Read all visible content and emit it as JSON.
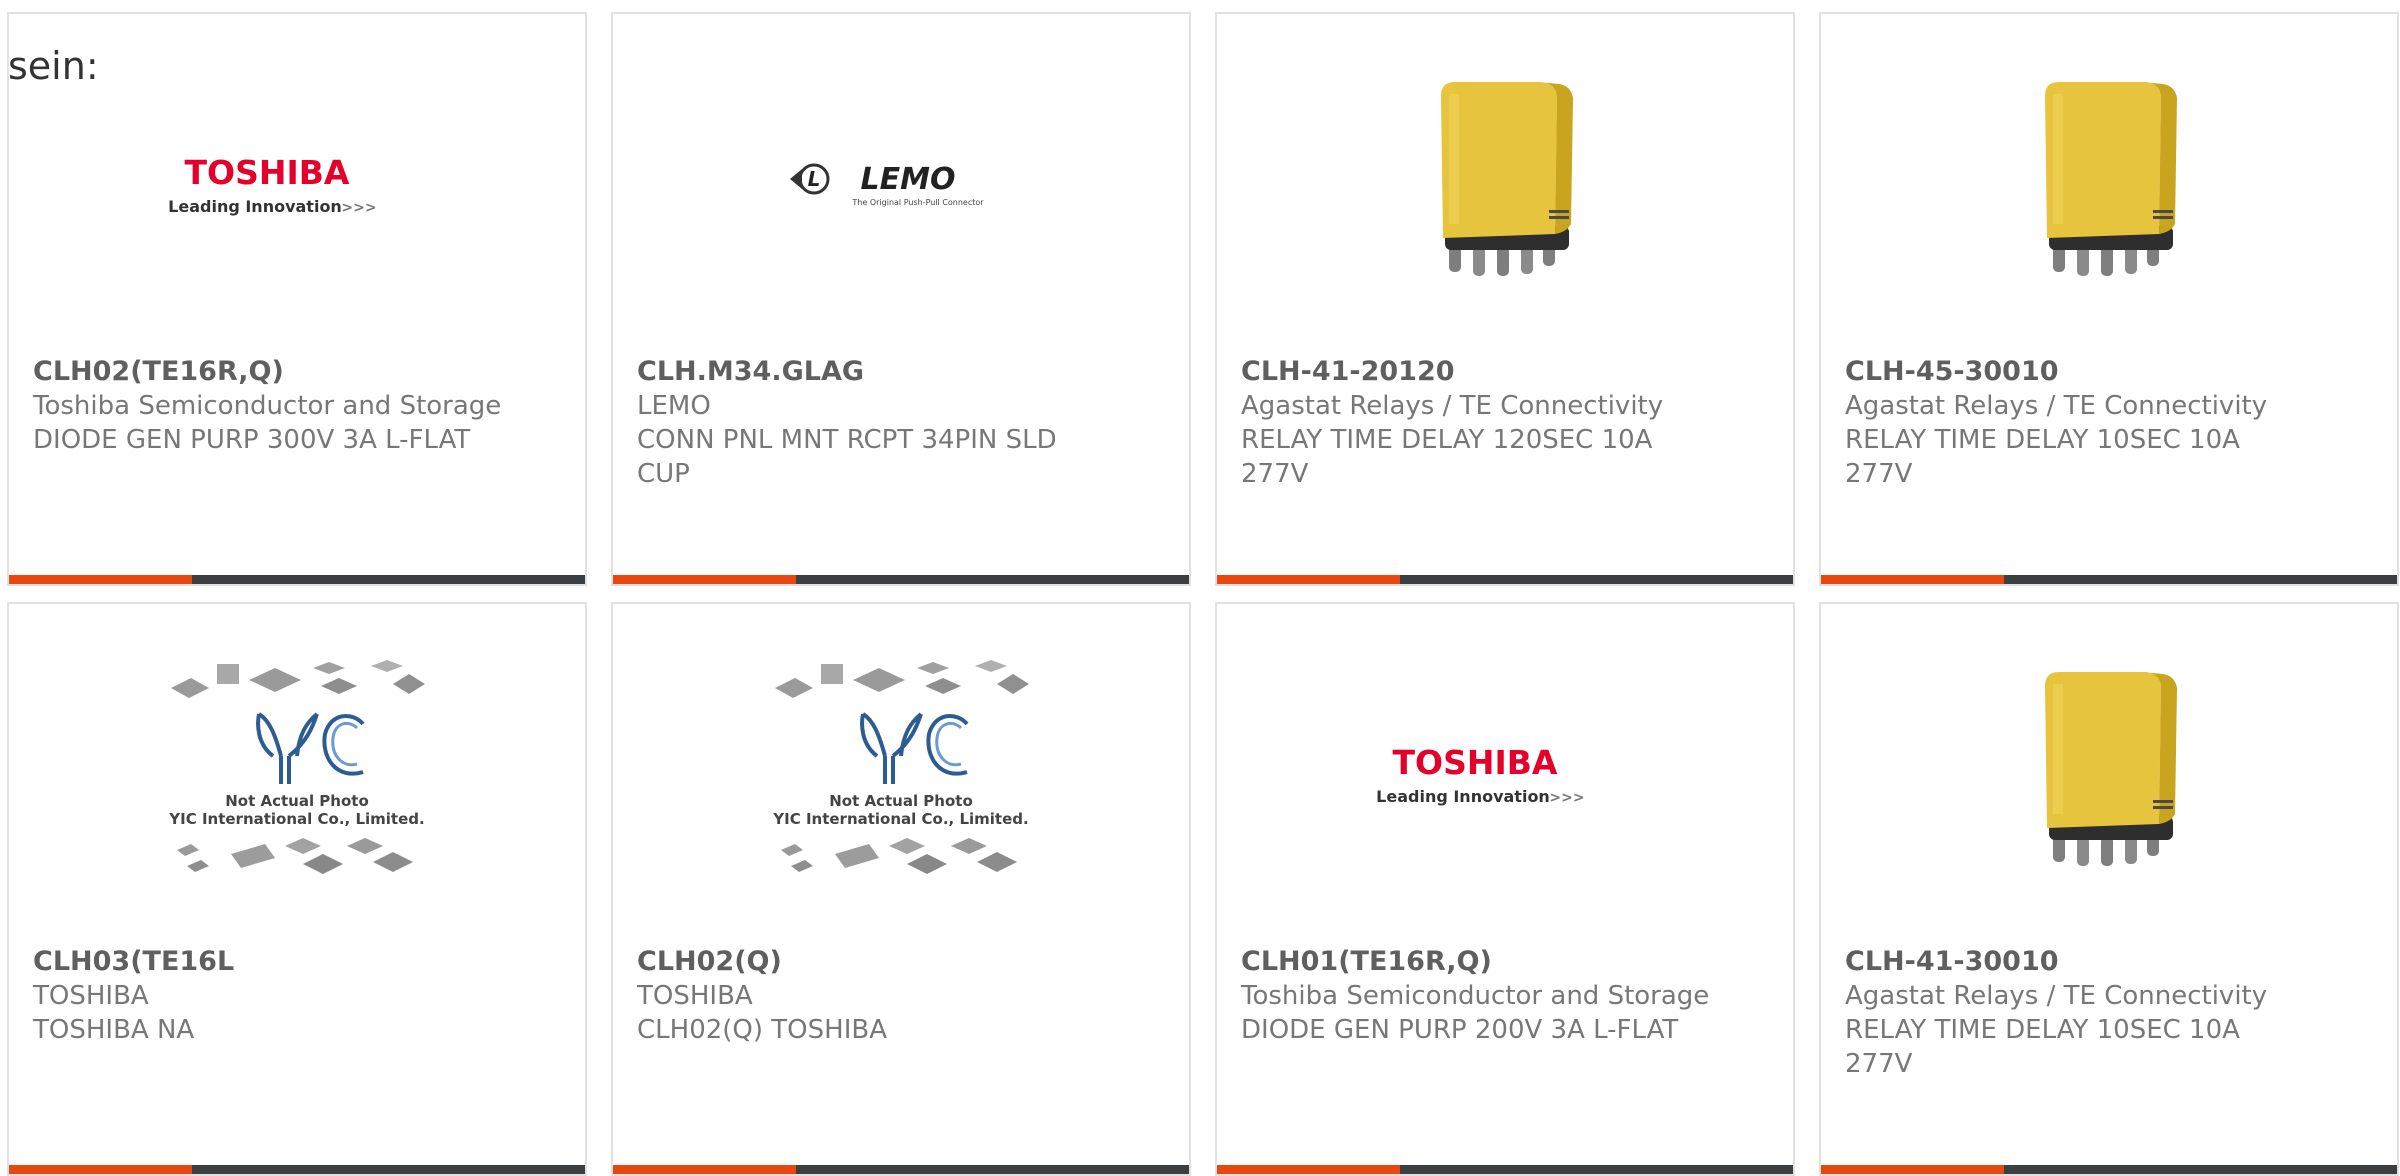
{
  "intro_text": "sein:",
  "colors": {
    "accent": "#e8470f",
    "bar": "#3c3f42",
    "toshiba_red": "#e4002b"
  },
  "logos": {
    "toshiba": {
      "brand": "TOSHIBA",
      "tagline": "Leading Innovation",
      "arrows": ">>>"
    },
    "lemo": {
      "brand": "LEMO",
      "tagline": "The Original Push-Pull Connector"
    },
    "yic": {
      "line1": "Not Actual Photo",
      "line2": "YIC International Co., Limited."
    }
  },
  "products": [
    {
      "image": "toshiba-logo",
      "part_number": "CLH02(TE16R,Q)",
      "manufacturer": "Toshiba Semiconductor and Storage",
      "description": "DIODE GEN PURP 300V 3A L-FLAT"
    },
    {
      "image": "lemo-logo",
      "part_number": "CLH.M34.GLAG",
      "manufacturer": "LEMO",
      "description": "CONN PNL MNT RCPT 34PIN SLD CUP"
    },
    {
      "image": "yellow-relay",
      "part_number": "CLH-41-20120",
      "manufacturer": "Agastat Relays / TE Connectivity",
      "description": "RELAY TIME DELAY 120SEC 10A 277V"
    },
    {
      "image": "yellow-relay",
      "part_number": "CLH-45-30010",
      "manufacturer": "Agastat Relays / TE Connectivity",
      "description": "RELAY TIME DELAY 10SEC 10A 277V"
    },
    {
      "image": "yic-placeholder",
      "part_number": "CLH03(TE16L",
      "manufacturer": "TOSHIBA",
      "description": "TOSHIBA NA"
    },
    {
      "image": "yic-placeholder",
      "part_number": "CLH02(Q)",
      "manufacturer": "TOSHIBA",
      "description": "CLH02(Q) TOSHIBA"
    },
    {
      "image": "toshiba-logo",
      "part_number": "CLH01(TE16R,Q)",
      "manufacturer": "Toshiba Semiconductor and Storage",
      "description": "DIODE GEN PURP 200V 3A L-FLAT"
    },
    {
      "image": "yellow-relay",
      "part_number": "CLH-41-30010",
      "manufacturer": "Agastat Relays / TE Connectivity",
      "description": "RELAY TIME DELAY 10SEC 10A 277V"
    }
  ]
}
